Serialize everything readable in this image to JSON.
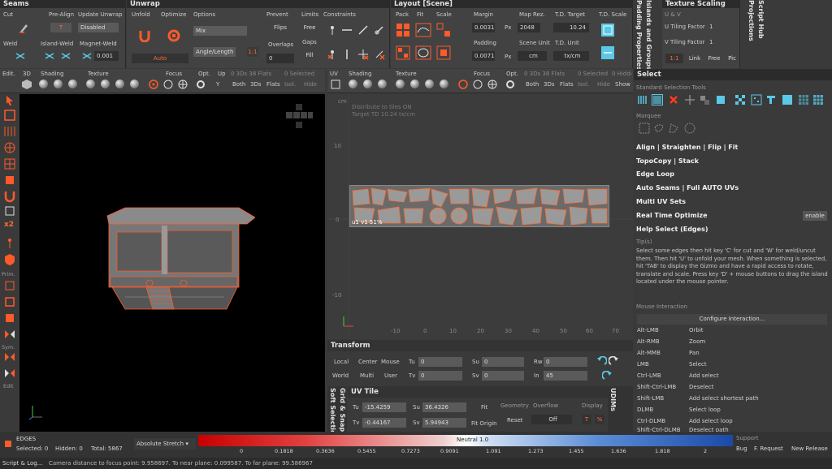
{
  "seams": {
    "title": "Seams",
    "cut_label": "Cut",
    "prealign_label": "Pre-Align",
    "prealign_value": "T",
    "update_unwrap_label": "Update Unwrap",
    "update_unwrap_value": "Disabled",
    "weld_label": "Weld",
    "island_weld_label": "Island-Weld",
    "magnet_weld_label": "Magnet-Weld",
    "magnet_value": "0.001"
  },
  "unwrap": {
    "title": "Unwrap",
    "unfold_label": "Unfold",
    "optimize_label": "Optimize",
    "options_label": "Options",
    "options_value": "Mix",
    "angle_value": "Angle/Length",
    "auto_label": "Auto",
    "ratio_label": "1:1",
    "prevent_label": "Prevent",
    "flips_label": "Flips",
    "overlaps_label": "Overlaps",
    "overlaps_value": "0",
    "limits_label": "Limits",
    "free_label": "Free",
    "gaps_label": "Gaps",
    "fill_label": "Fill",
    "constraints_label": "Constraints"
  },
  "layout": {
    "title": "Layout [Scene]",
    "pack_label": "Pack",
    "fit_label": "Fit",
    "scale_label": "Scale",
    "margin_label": "Margin",
    "margin_value": "0.0031",
    "margin_unit": "Px",
    "maprez_label": "Map Rez.",
    "maprez_value": "2048",
    "padding_label": "Padding",
    "padding_value": "0.0071",
    "padding_unit": "Px",
    "scene_unit_label": "Scene Unit",
    "scene_unit_value": "cm",
    "td_target_label": "T.D. Target",
    "td_target_value": "10.24",
    "td_unit_label": "T.D. Unit",
    "td_unit_value": "tx/cm",
    "td_scale_label": "T.D. Scale"
  },
  "side_tabs": {
    "padding_props": "Padding Properties",
    "islands_groups": "Islands and Groups",
    "script_hub": "Script Hub",
    "projections": "Projections"
  },
  "texture_scaling": {
    "title": "Texture Scaling",
    "uv_label": "U & V",
    "u_label": "U Tiling Factor",
    "u_value": "1",
    "v_label": "V Tiling Factor",
    "v_value": "1",
    "ratio_label": "1:1",
    "link_label": "Link",
    "free_label": "Free",
    "pic_label": "Pic"
  },
  "view3d_toolbar": {
    "edit": "Edit.",
    "mode": "3D",
    "shading": "Shading",
    "texture": "Texture",
    "focus": "Focus",
    "opt": "Opt.",
    "up": "Up",
    "up_value": "Y",
    "stats": "0 3Ds 38 Flats",
    "selected": "0 Selected",
    "both": "Both",
    "threeds": "3Ds",
    "flats": "Flats",
    "isol": "Isol.",
    "hide": "Hide"
  },
  "viewuv_toolbar": {
    "mode": "UV",
    "shading": "Shading",
    "texture": "Texture",
    "focus": "Focus",
    "opt": "Opt.",
    "stats": "0 3Ds 38 Flats",
    "selected": "0 Selected",
    "hidden": "0 Hidden",
    "both": "Both",
    "threeds": "3Ds",
    "flats": "Flats",
    "isol": "Isol.",
    "hide": "Hide",
    "show": "Show"
  },
  "left_tools": {
    "prim": "Prim.",
    "sym": "Sym.",
    "edit": "Edit",
    "x2": "x2"
  },
  "uv_view": {
    "unit": "cm",
    "distribute": "Distribute to tiles  ON",
    "target_td": "Target TD  10.24 tx/cm",
    "axis_y": [
      "10",
      "0",
      "-10"
    ],
    "axis_x": [
      "-10",
      "0",
      "10",
      "20",
      "30",
      "40",
      "50",
      "60",
      "70"
    ],
    "tile_label": "u1 v1   51%"
  },
  "transform": {
    "title": "Transform",
    "local": "Local",
    "center": "Center",
    "mouse": "Mouse",
    "world": "World",
    "multi": "Multi",
    "user": "User",
    "tu_label": "Tu",
    "tu_value": "0",
    "tv_label": "Tv",
    "tv_value": "0",
    "su_label": "Su",
    "su_value": "0",
    "sv_label": "Sv",
    "sv_value": "0",
    "rw_label": "Rw",
    "rw_value": "0",
    "in_label": "In",
    "in_value": "45"
  },
  "uvtile": {
    "title": "UV Tile",
    "tu_label": "Tu",
    "tu_value": "-15.4259",
    "su_label": "Su",
    "su_value": "36.4326",
    "tv_label": "Tv",
    "tv_value": "-0.44167",
    "sv_label": "Sv",
    "sv_value": "5.94943",
    "fit": "Fit",
    "fit_origin": "Fit Origin",
    "geometry": "Geometry",
    "overflow": "Overflow",
    "reset": "Reset",
    "off": "Off",
    "display": "Display",
    "t_label": "T",
    "pct_label": "%"
  },
  "uvtile_side": {
    "grid": "Grid & Snap",
    "soft": "Soft Selection",
    "udims": "UDIMs"
  },
  "select_panel": {
    "title": "Select",
    "std_tools": "Standard Selection Tools",
    "marquee": "Marquee",
    "items": [
      "Align | Straighten | Flip | Fit",
      "TopoCopy | Stack",
      "Edge Loop",
      "Auto Seams | Full AUTO UVs",
      "Multi UV Sets",
      "Real Time Optimize",
      "Help Select (Edges)"
    ],
    "enable": "enable",
    "tips_title": "Tip(s)",
    "tips_text": "Select some edges then hit key 'C' for cut and 'W' for weld/uncut them. Then hit 'U' to unfold your mesh. When something is selected, hit 'TAB' to display the Gizmo and have a rapid access to rotate, translate and scale. Press key 'D' + mouse buttons to drag the island located under the mouse pointer.",
    "mouse_interaction": "Mouse Interaction",
    "configure": "Configure Interaction...",
    "bindings": [
      [
        "Alt-LMB",
        "Orbit"
      ],
      [
        "Alt-RMB",
        "Zoom"
      ],
      [
        "Alt-MMB",
        "Pan"
      ],
      [
        "LMB",
        "Select"
      ],
      [
        "Ctrl-LMB",
        "Add select"
      ],
      [
        "Shift-Ctrl-LMB",
        "Deselect"
      ],
      [
        "Shift-LMB",
        "Add select shortest path"
      ],
      [
        "DLMB",
        "Select loop"
      ],
      [
        "Ctrl-DLMB",
        "Add select loop"
      ],
      [
        "Shift-Ctrl-DLMB",
        "Deselect path"
      ]
    ]
  },
  "status": {
    "mode": "EDGES",
    "selected": "Selected: 0",
    "hidden": "Hidden: 0",
    "total": "Total: 5867",
    "stretch": "Absolute Stretch",
    "neutral": "Neutral 1.0",
    "ticks": [
      "0",
      "0.1818",
      "0.3636",
      "0.5455",
      "0.7273",
      "0.9091",
      "1.091",
      "1.273",
      "1.455",
      "1.636",
      "1.818",
      "2"
    ],
    "support": "Support",
    "bug": "Bug",
    "request": "F. Request",
    "release": "New Release",
    "script_log": "Script & Log...",
    "camera": "Camera distance to focus point: 9.958697. To near plane: 0.099587. To far plane: 99.586967"
  },
  "colors": {
    "accent": "#ff5a2a",
    "panel": "#424242",
    "viewport": "#000000",
    "uv_bg": "#3c3c3c"
  }
}
